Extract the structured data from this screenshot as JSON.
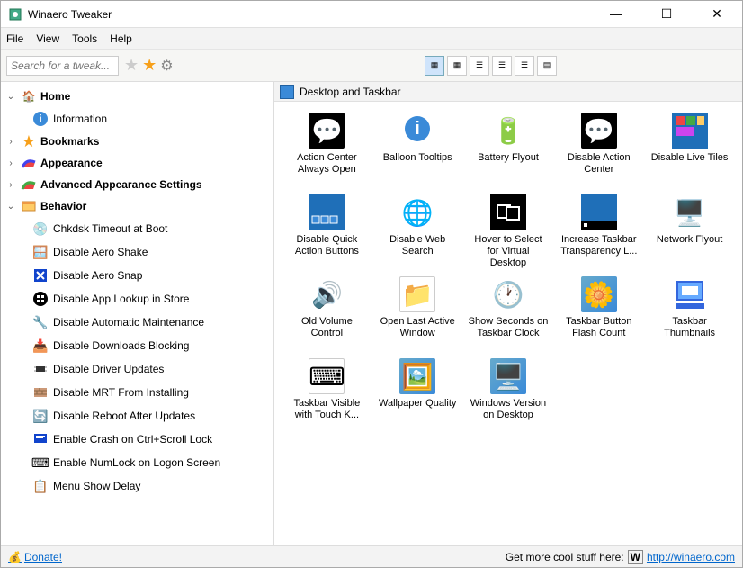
{
  "window": {
    "title": "Winaero Tweaker"
  },
  "menubar": {
    "file": "File",
    "view": "View",
    "tools": "Tools",
    "help": "Help"
  },
  "toolbar": {
    "search_placeholder": "Search for a tweak..."
  },
  "sidebar": {
    "home": "Home",
    "information": "Information",
    "bookmarks": "Bookmarks",
    "appearance": "Appearance",
    "advanced": "Advanced Appearance Settings",
    "behavior": "Behavior",
    "children": {
      "c0": "Chkdsk Timeout at Boot",
      "c1": "Disable Aero Shake",
      "c2": "Disable Aero Snap",
      "c3": "Disable App Lookup in Store",
      "c4": "Disable Automatic Maintenance",
      "c5": "Disable Downloads Blocking",
      "c6": "Disable Driver Updates",
      "c7": "Disable MRT From Installing",
      "c8": "Disable Reboot After Updates",
      "c9": "Enable Crash on Ctrl+Scroll Lock",
      "c10": "Enable NumLock on Logon Screen",
      "c11": "Menu Show Delay"
    }
  },
  "pane": {
    "title": "Desktop and Taskbar"
  },
  "tiles": {
    "t0": "Action Center Always Open",
    "t1": "Balloon Tooltips",
    "t2": "Battery Flyout",
    "t3": "Disable Action Center",
    "t4": "Disable Live Tiles",
    "t5": "Disable Quick Action Buttons",
    "t6": "Disable Web Search",
    "t7": "Hover to Select for Virtual Desktop",
    "t8": "Increase Taskbar Transparency L...",
    "t9": "Network Flyout",
    "t10": "Old Volume Control",
    "t11": "Open Last Active Window",
    "t12": "Show Seconds on Taskbar Clock",
    "t13": "Taskbar Button Flash Count",
    "t14": "Taskbar Thumbnails",
    "t15": "Taskbar Visible with Touch K...",
    "t16": "Wallpaper Quality",
    "t17": "Windows Version on Desktop"
  },
  "status": {
    "donate": "Donate!",
    "right_text": "Get more cool stuff here:",
    "url": "http://winaero.com"
  }
}
